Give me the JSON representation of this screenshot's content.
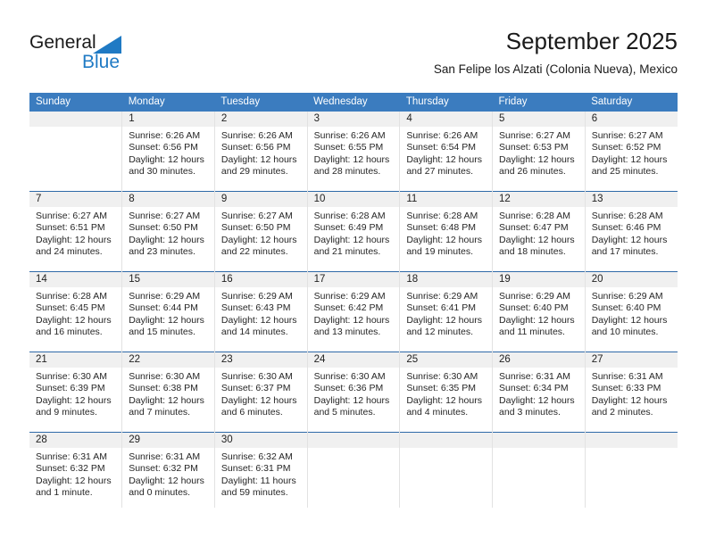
{
  "brand": {
    "name_dark": "General",
    "name_blue": "Blue",
    "triangle_color": "#1f7ac4"
  },
  "header": {
    "title": "September 2025",
    "subtitle": "San Felipe los Alzati (Colonia Nueva), Mexico"
  },
  "colors": {
    "header_blue": "#3b7cbf",
    "row_divider_blue": "#2f6aa8",
    "daynum_band": "#f0f0f0",
    "cell_divider": "#e2e2e2",
    "text": "#262626"
  },
  "weekday_headers": [
    "Sunday",
    "Monday",
    "Tuesday",
    "Wednesday",
    "Thursday",
    "Friday",
    "Saturday"
  ],
  "weeks": [
    [
      {
        "day": "",
        "sunrise": "",
        "sunset": "",
        "daylight1": "",
        "daylight2": ""
      },
      {
        "day": "1",
        "sunrise": "Sunrise: 6:26 AM",
        "sunset": "Sunset: 6:56 PM",
        "daylight1": "Daylight: 12 hours",
        "daylight2": "and 30 minutes."
      },
      {
        "day": "2",
        "sunrise": "Sunrise: 6:26 AM",
        "sunset": "Sunset: 6:56 PM",
        "daylight1": "Daylight: 12 hours",
        "daylight2": "and 29 minutes."
      },
      {
        "day": "3",
        "sunrise": "Sunrise: 6:26 AM",
        "sunset": "Sunset: 6:55 PM",
        "daylight1": "Daylight: 12 hours",
        "daylight2": "and 28 minutes."
      },
      {
        "day": "4",
        "sunrise": "Sunrise: 6:26 AM",
        "sunset": "Sunset: 6:54 PM",
        "daylight1": "Daylight: 12 hours",
        "daylight2": "and 27 minutes."
      },
      {
        "day": "5",
        "sunrise": "Sunrise: 6:27 AM",
        "sunset": "Sunset: 6:53 PM",
        "daylight1": "Daylight: 12 hours",
        "daylight2": "and 26 minutes."
      },
      {
        "day": "6",
        "sunrise": "Sunrise: 6:27 AM",
        "sunset": "Sunset: 6:52 PM",
        "daylight1": "Daylight: 12 hours",
        "daylight2": "and 25 minutes."
      }
    ],
    [
      {
        "day": "7",
        "sunrise": "Sunrise: 6:27 AM",
        "sunset": "Sunset: 6:51 PM",
        "daylight1": "Daylight: 12 hours",
        "daylight2": "and 24 minutes."
      },
      {
        "day": "8",
        "sunrise": "Sunrise: 6:27 AM",
        "sunset": "Sunset: 6:50 PM",
        "daylight1": "Daylight: 12 hours",
        "daylight2": "and 23 minutes."
      },
      {
        "day": "9",
        "sunrise": "Sunrise: 6:27 AM",
        "sunset": "Sunset: 6:50 PM",
        "daylight1": "Daylight: 12 hours",
        "daylight2": "and 22 minutes."
      },
      {
        "day": "10",
        "sunrise": "Sunrise: 6:28 AM",
        "sunset": "Sunset: 6:49 PM",
        "daylight1": "Daylight: 12 hours",
        "daylight2": "and 21 minutes."
      },
      {
        "day": "11",
        "sunrise": "Sunrise: 6:28 AM",
        "sunset": "Sunset: 6:48 PM",
        "daylight1": "Daylight: 12 hours",
        "daylight2": "and 19 minutes."
      },
      {
        "day": "12",
        "sunrise": "Sunrise: 6:28 AM",
        "sunset": "Sunset: 6:47 PM",
        "daylight1": "Daylight: 12 hours",
        "daylight2": "and 18 minutes."
      },
      {
        "day": "13",
        "sunrise": "Sunrise: 6:28 AM",
        "sunset": "Sunset: 6:46 PM",
        "daylight1": "Daylight: 12 hours",
        "daylight2": "and 17 minutes."
      }
    ],
    [
      {
        "day": "14",
        "sunrise": "Sunrise: 6:28 AM",
        "sunset": "Sunset: 6:45 PM",
        "daylight1": "Daylight: 12 hours",
        "daylight2": "and 16 minutes."
      },
      {
        "day": "15",
        "sunrise": "Sunrise: 6:29 AM",
        "sunset": "Sunset: 6:44 PM",
        "daylight1": "Daylight: 12 hours",
        "daylight2": "and 15 minutes."
      },
      {
        "day": "16",
        "sunrise": "Sunrise: 6:29 AM",
        "sunset": "Sunset: 6:43 PM",
        "daylight1": "Daylight: 12 hours",
        "daylight2": "and 14 minutes."
      },
      {
        "day": "17",
        "sunrise": "Sunrise: 6:29 AM",
        "sunset": "Sunset: 6:42 PM",
        "daylight1": "Daylight: 12 hours",
        "daylight2": "and 13 minutes."
      },
      {
        "day": "18",
        "sunrise": "Sunrise: 6:29 AM",
        "sunset": "Sunset: 6:41 PM",
        "daylight1": "Daylight: 12 hours",
        "daylight2": "and 12 minutes."
      },
      {
        "day": "19",
        "sunrise": "Sunrise: 6:29 AM",
        "sunset": "Sunset: 6:40 PM",
        "daylight1": "Daylight: 12 hours",
        "daylight2": "and 11 minutes."
      },
      {
        "day": "20",
        "sunrise": "Sunrise: 6:29 AM",
        "sunset": "Sunset: 6:40 PM",
        "daylight1": "Daylight: 12 hours",
        "daylight2": "and 10 minutes."
      }
    ],
    [
      {
        "day": "21",
        "sunrise": "Sunrise: 6:30 AM",
        "sunset": "Sunset: 6:39 PM",
        "daylight1": "Daylight: 12 hours",
        "daylight2": "and 9 minutes."
      },
      {
        "day": "22",
        "sunrise": "Sunrise: 6:30 AM",
        "sunset": "Sunset: 6:38 PM",
        "daylight1": "Daylight: 12 hours",
        "daylight2": "and 7 minutes."
      },
      {
        "day": "23",
        "sunrise": "Sunrise: 6:30 AM",
        "sunset": "Sunset: 6:37 PM",
        "daylight1": "Daylight: 12 hours",
        "daylight2": "and 6 minutes."
      },
      {
        "day": "24",
        "sunrise": "Sunrise: 6:30 AM",
        "sunset": "Sunset: 6:36 PM",
        "daylight1": "Daylight: 12 hours",
        "daylight2": "and 5 minutes."
      },
      {
        "day": "25",
        "sunrise": "Sunrise: 6:30 AM",
        "sunset": "Sunset: 6:35 PM",
        "daylight1": "Daylight: 12 hours",
        "daylight2": "and 4 minutes."
      },
      {
        "day": "26",
        "sunrise": "Sunrise: 6:31 AM",
        "sunset": "Sunset: 6:34 PM",
        "daylight1": "Daylight: 12 hours",
        "daylight2": "and 3 minutes."
      },
      {
        "day": "27",
        "sunrise": "Sunrise: 6:31 AM",
        "sunset": "Sunset: 6:33 PM",
        "daylight1": "Daylight: 12 hours",
        "daylight2": "and 2 minutes."
      }
    ],
    [
      {
        "day": "28",
        "sunrise": "Sunrise: 6:31 AM",
        "sunset": "Sunset: 6:32 PM",
        "daylight1": "Daylight: 12 hours",
        "daylight2": "and 1 minute."
      },
      {
        "day": "29",
        "sunrise": "Sunrise: 6:31 AM",
        "sunset": "Sunset: 6:32 PM",
        "daylight1": "Daylight: 12 hours",
        "daylight2": "and 0 minutes."
      },
      {
        "day": "30",
        "sunrise": "Sunrise: 6:32 AM",
        "sunset": "Sunset: 6:31 PM",
        "daylight1": "Daylight: 11 hours",
        "daylight2": "and 59 minutes."
      },
      {
        "day": "",
        "sunrise": "",
        "sunset": "",
        "daylight1": "",
        "daylight2": ""
      },
      {
        "day": "",
        "sunrise": "",
        "sunset": "",
        "daylight1": "",
        "daylight2": ""
      },
      {
        "day": "",
        "sunrise": "",
        "sunset": "",
        "daylight1": "",
        "daylight2": ""
      },
      {
        "day": "",
        "sunrise": "",
        "sunset": "",
        "daylight1": "",
        "daylight2": ""
      }
    ]
  ]
}
